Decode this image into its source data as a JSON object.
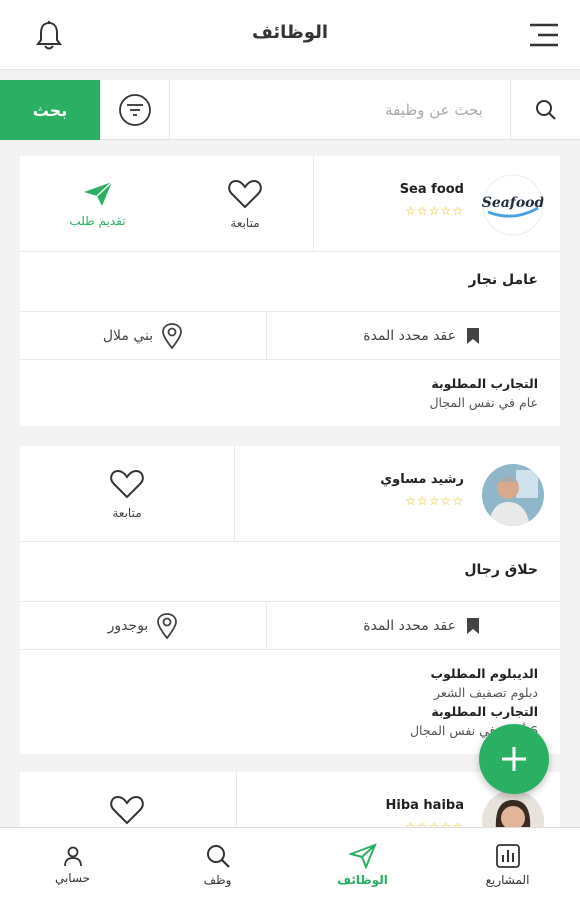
{
  "header": {
    "title": "الوظائف"
  },
  "search": {
    "button_label": "بحث",
    "placeholder": "بحث عن وظيفة"
  },
  "cards": [
    {
      "company": "Sea food",
      "logo_text": "Seafood",
      "stars": "☆☆☆☆☆",
      "follow_label": "متابعة",
      "apply_label": "تقديم طلب",
      "job_title": "عامل نجار",
      "contract": "عقد محدد المدة",
      "location": "بني ملال",
      "requirements": [
        {
          "heading": "التجارب المطلوبة",
          "value": "عام في نفس المجال"
        }
      ]
    },
    {
      "company": "رشيد مساوي",
      "stars": "☆☆☆☆☆",
      "follow_label": "متابعة",
      "job_title": "حلاق رجال",
      "contract": "عقد محدد المدة",
      "location": "بوجدور",
      "requirements": [
        {
          "heading": "الديبلوم المطلوب",
          "value": "دبلوم تصفيف الشعر"
        },
        {
          "heading": "التجارب المطلوبة",
          "value": "6 أشهر في نفس المجال"
        }
      ]
    },
    {
      "company": "Hiba haiba",
      "stars": "☆☆☆☆☆"
    }
  ],
  "nav": [
    {
      "label": "حسابي",
      "icon": "user-icon"
    },
    {
      "label": "وظف",
      "icon": "search-icon"
    },
    {
      "label": "الوظائف",
      "icon": "send-icon",
      "active": true
    },
    {
      "label": "المشاريع",
      "icon": "chart-icon"
    }
  ],
  "colors": {
    "accent": "#2bb063",
    "star": "#e6b800"
  }
}
